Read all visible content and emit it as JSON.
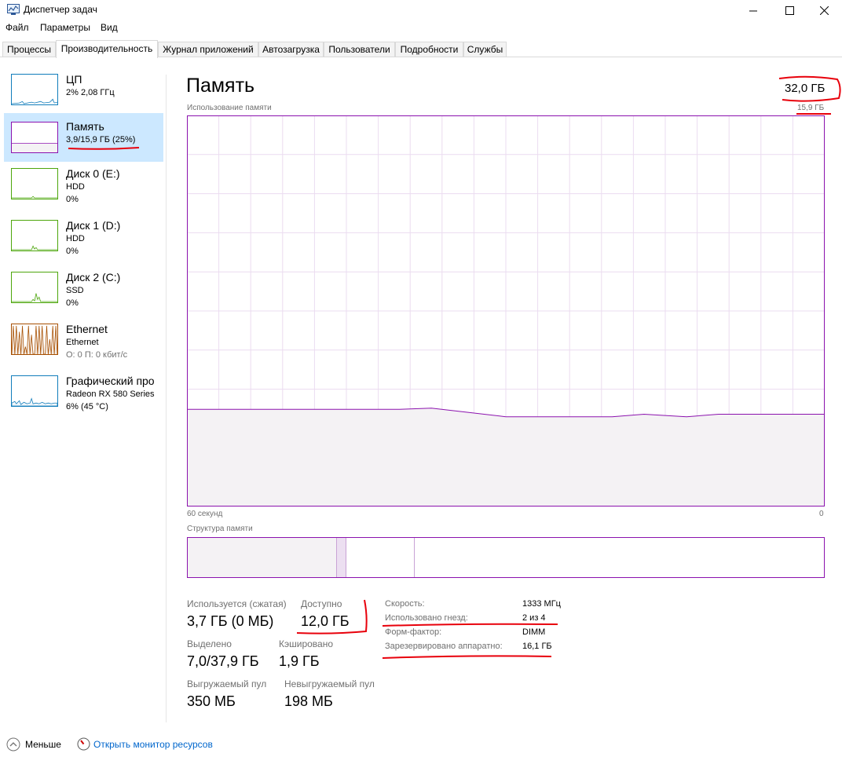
{
  "window": {
    "title": "Диспетчер задач",
    "minimize_icon": "minimize-icon",
    "maximize_icon": "maximize-icon",
    "close_icon": "close-icon"
  },
  "menu": [
    "Файл",
    "Параметры",
    "Вид"
  ],
  "tabs": [
    "Процессы",
    "Производительность",
    "Журнал приложений",
    "Автозагрузка",
    "Пользователи",
    "Подробности",
    "Службы"
  ],
  "active_tab": "Производительность",
  "sidebar": {
    "items": [
      {
        "name": "ЦП",
        "line1": "2% 2,08 ГГц",
        "line2": "",
        "color": "#117dbb"
      },
      {
        "name": "Память",
        "line1": "3,9/15,9 ГБ (25%)",
        "line2": "",
        "color": "#8b12ae"
      },
      {
        "name": "Диск 0 (E:)",
        "line1": "HDD",
        "line2": "0%",
        "color": "#4da60c"
      },
      {
        "name": "Диск 1 (D:)",
        "line1": "HDD",
        "line2": "0%",
        "color": "#4da60c"
      },
      {
        "name": "Диск 2 (C:)",
        "line1": "SSD",
        "line2": "0%",
        "color": "#4da60c"
      },
      {
        "name": "Ethernet",
        "line1": "Ethernet",
        "line2": "О: 0 П: 0 кбит/с",
        "color": "#a74f01"
      },
      {
        "name": "Графический про",
        "line1": "Radeon RX 580 Series",
        "line2": "6% (45 °C)",
        "color": "#117dbb"
      }
    ]
  },
  "main": {
    "title": "Память",
    "total": "32,0 ГБ",
    "chart_label": "Использование памяти",
    "chart_max": "15,9 ГБ",
    "chart_left": "60 секунд",
    "chart_right": "0",
    "structure_label": "Структура памяти",
    "stats": {
      "in_use_label": "Используется (сжатая)",
      "in_use_value": "3,7 ГБ (0 МБ)",
      "available_label": "Доступно",
      "available_value": "12,0 ГБ",
      "committed_label": "Выделено",
      "committed_value": "7,0/37,9 ГБ",
      "cached_label": "Кэшировано",
      "cached_value": "1,9 ГБ",
      "paged_label": "Выгружаемый пул",
      "paged_value": "350 МБ",
      "nonpaged_label": "Невыгружаемый пул",
      "nonpaged_value": "198 МБ"
    },
    "props": [
      {
        "label": "Скорость:",
        "value": "1333 МГц"
      },
      {
        "label": "Использовано гнезд:",
        "value": "2 из 4"
      },
      {
        "label": "Форм-фактор:",
        "value": "DIMM"
      },
      {
        "label": "Зарезервировано аппаратно:",
        "value": "16,1 ГБ"
      }
    ]
  },
  "footer": {
    "less_label": "Меньше",
    "monitor_link": "Открыть монитор ресурсов"
  },
  "colors": {
    "memory": "#8b12ae",
    "grid": "#ebdcf0",
    "fill": "#f4f2f4",
    "annotation": "#e8000b"
  },
  "chart_data": {
    "type": "area",
    "ylabel": "Использование памяти",
    "ylim": [
      0,
      15.9
    ],
    "xlim": [
      60,
      0
    ],
    "x": [
      60,
      52,
      44,
      40,
      37,
      30,
      25,
      20,
      17,
      13,
      10,
      7,
      4,
      0
    ],
    "y": [
      3.95,
      3.95,
      3.95,
      3.95,
      4.0,
      3.65,
      3.65,
      3.65,
      3.75,
      3.65,
      3.75,
      3.75,
      3.75,
      3.75
    ]
  }
}
